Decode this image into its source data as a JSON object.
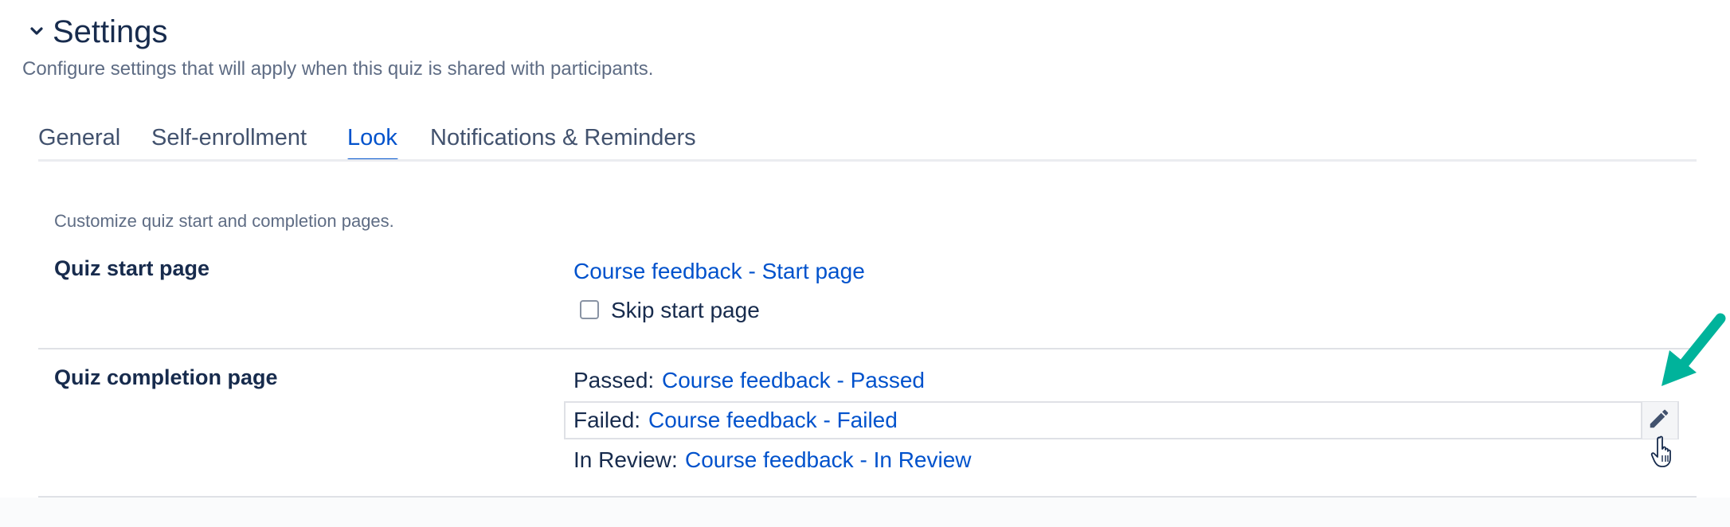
{
  "header": {
    "title": "Settings",
    "subtitle": "Configure settings that will apply when this quiz is shared with participants.",
    "toggle_icon": "chevron-down-icon"
  },
  "tabs": [
    {
      "label": "General",
      "active": false
    },
    {
      "label": "Self-enrollment",
      "active": false
    },
    {
      "label": "Look",
      "active": true
    },
    {
      "label": "Notifications & Reminders",
      "active": false
    }
  ],
  "look": {
    "description": "Customize quiz start and completion pages.",
    "start_page": {
      "label": "Quiz start page",
      "link": "Course feedback - Start page",
      "skip_label": "Skip start page",
      "skip_checked": false
    },
    "completion_page": {
      "label": "Quiz completion page",
      "passed": {
        "prefix": "Passed:",
        "link": "Course feedback - Passed"
      },
      "failed": {
        "prefix": "Failed:",
        "link": "Course feedback - Failed"
      },
      "in_review": {
        "prefix": "In Review:",
        "link": "Course feedback - In Review"
      },
      "edit_icon": "pencil-icon"
    }
  },
  "colors": {
    "accent": "#0052cc",
    "text": "#172b4d",
    "muted": "#5e6c84",
    "annotation_arrow": "#00b39b"
  }
}
